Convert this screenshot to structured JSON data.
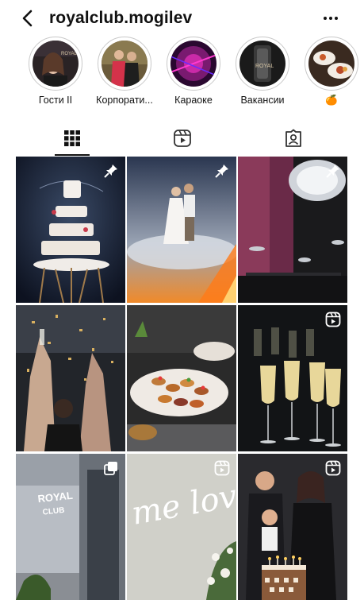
{
  "header": {
    "username": "royalclub.mogilev",
    "back_icon": "chevron-left-icon",
    "more_icon": "more-horizontal-icon"
  },
  "highlights": [
    {
      "label": "Гости II"
    },
    {
      "label": "Корпорати..."
    },
    {
      "label": "Караоке"
    },
    {
      "label": "Вакансии"
    },
    {
      "label": "🍊"
    }
  ],
  "tabs": [
    {
      "name": "grid",
      "icon": "grid-icon",
      "active": true
    },
    {
      "name": "reels",
      "icon": "reels-icon",
      "active": false
    },
    {
      "name": "tagged",
      "icon": "tagged-icon",
      "active": false
    }
  ],
  "posts": [
    {
      "scene": "dessert-tower",
      "badge": "pin-icon"
    },
    {
      "scene": "wedding-dance",
      "badge": "pin-icon"
    },
    {
      "scene": "club-interior",
      "badge": "pin-icon"
    },
    {
      "scene": "confetti-party",
      "badge": ""
    },
    {
      "scene": "canapes-plate",
      "badge": ""
    },
    {
      "scene": "champagne-glasses",
      "badge": "reels-icon"
    },
    {
      "scene": "club-entrance",
      "badge": "carousel-icon"
    },
    {
      "scene": "neon-love-sign",
      "badge": "reels-icon"
    },
    {
      "scene": "birthday-family",
      "badge": "reels-icon"
    }
  ],
  "overlay_text": {
    "entrance_sign_line1": "ROYAL",
    "entrance_sign_line2": "CLUB",
    "neon_sign": "me love"
  },
  "colors": {
    "text": "#111111",
    "ring": "#c9c9c9",
    "active_tab": "#111111"
  }
}
